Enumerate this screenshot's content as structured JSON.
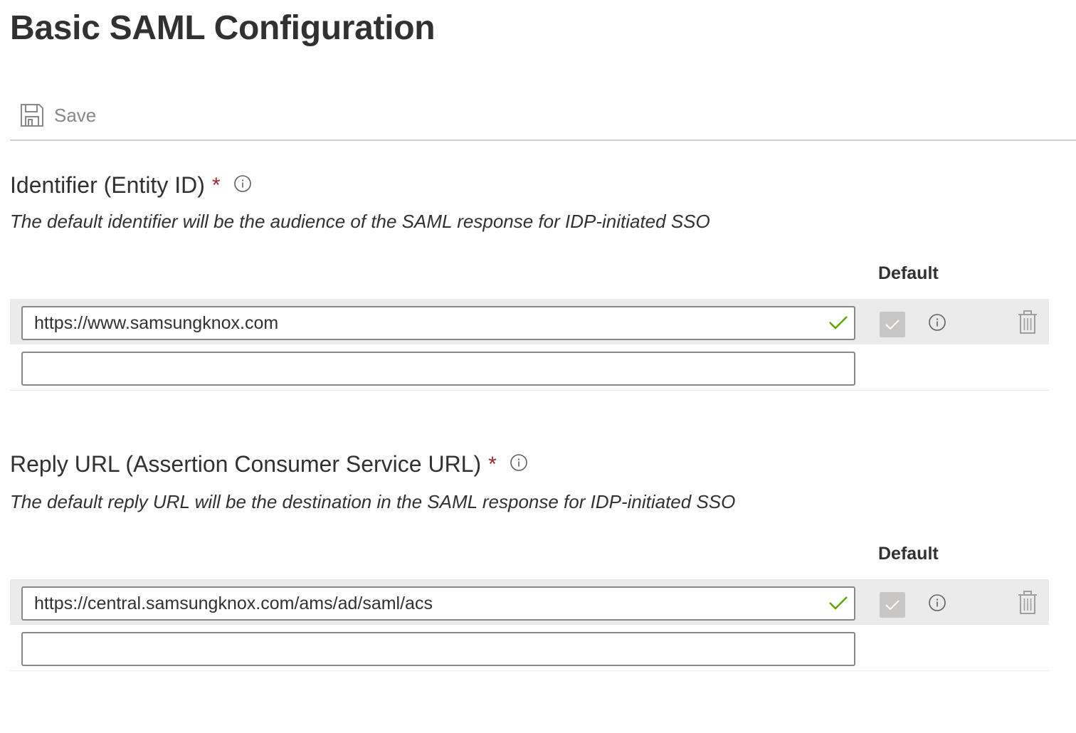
{
  "page": {
    "title": "Basic SAML Configuration"
  },
  "toolbar": {
    "save_label": "Save",
    "save_icon": "floppy-disk-icon"
  },
  "identifier": {
    "title": "Identifier (Entity ID)",
    "required_mark": "*",
    "description": "The default identifier will be the audience of the SAML response for IDP-initiated SSO",
    "default_header": "Default",
    "rows": [
      {
        "value": "https://www.samsungknox.com",
        "valid": true,
        "is_default": true
      },
      {
        "value": "",
        "placeholder": ""
      }
    ]
  },
  "reply_url": {
    "title": "Reply URL (Assertion Consumer Service URL)",
    "required_mark": "*",
    "description": "The default reply URL will be the destination in the SAML response for IDP-initiated SSO",
    "default_header": "Default",
    "rows": [
      {
        "value": "https://central.samsungknox.com/ams/ad/saml/acs",
        "valid": true,
        "is_default": true
      },
      {
        "value": "",
        "placeholder": ""
      }
    ]
  },
  "colors": {
    "required": "#a4262c",
    "valid_check": "#57a300",
    "row_highlight": "#ebebeb",
    "disabled_checkbox": "#c8c6c4"
  }
}
